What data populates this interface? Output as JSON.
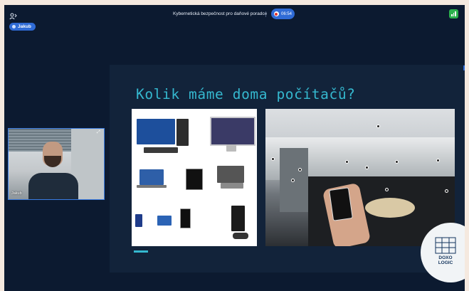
{
  "header": {
    "user_chip": "Jakub",
    "meeting_title": "Kybernetická bezpečnost pro daňové poradce",
    "timer": "06:54"
  },
  "slide": {
    "title": "Kolik máme doma počítačů?",
    "logo_text_line1": "DOXO",
    "logo_text_line2": "LOGIC"
  },
  "camera": {
    "name": "Jakub"
  },
  "colors": {
    "background": "#0c1a30",
    "accent": "#2f6bd6",
    "slide_title": "#35b8cf",
    "status_green": "#2bb14c",
    "record_red": "#e0332d"
  }
}
